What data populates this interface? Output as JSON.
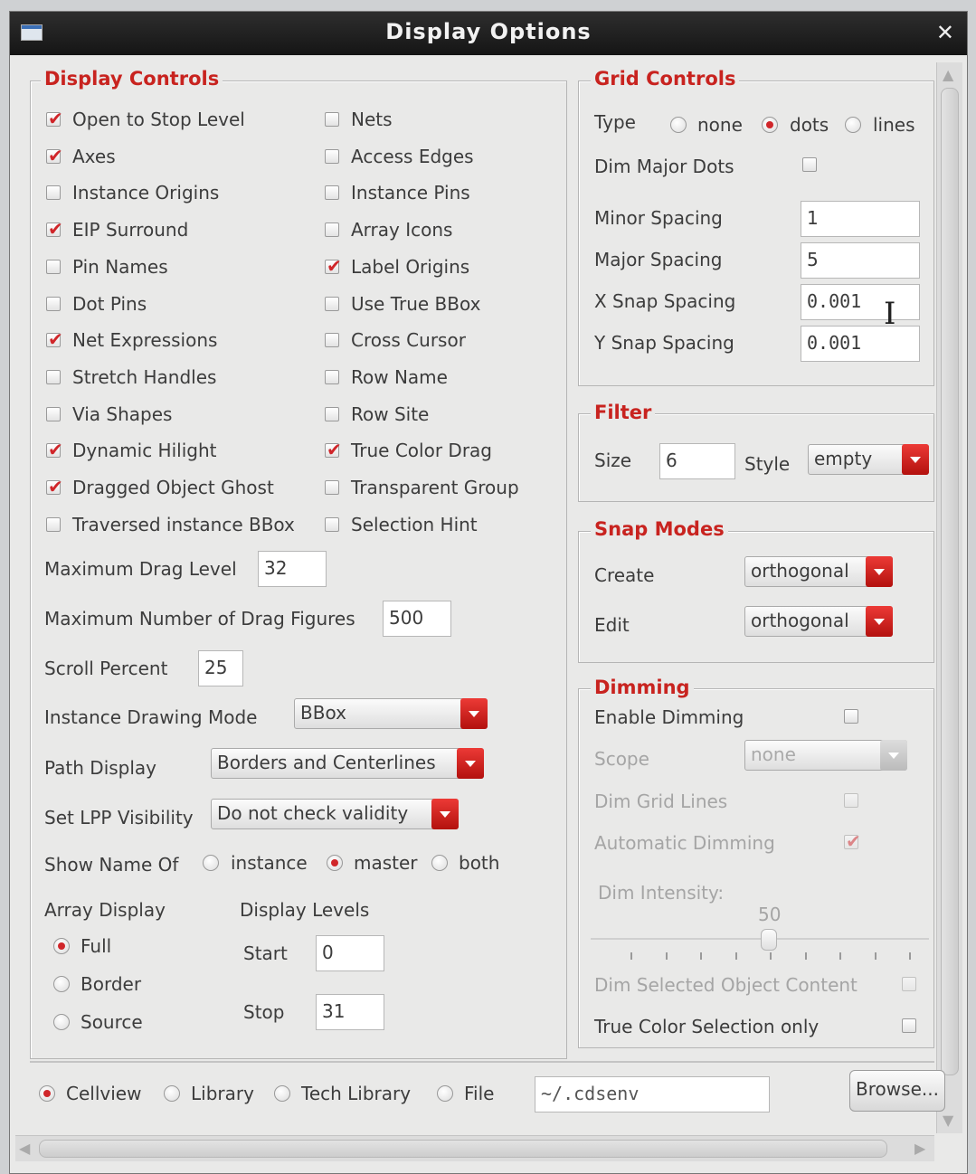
{
  "window": {
    "title": "Display Options"
  },
  "display_controls": {
    "legend": "Display Controls",
    "left_checks": [
      {
        "label": "Open to Stop Level",
        "checked": true
      },
      {
        "label": "Axes",
        "checked": true
      },
      {
        "label": "Instance Origins",
        "checked": false
      },
      {
        "label": "EIP Surround",
        "checked": true
      },
      {
        "label": "Pin Names",
        "checked": false
      },
      {
        "label": "Dot Pins",
        "checked": false
      },
      {
        "label": "Net Expressions",
        "checked": true
      },
      {
        "label": "Stretch Handles",
        "checked": false
      },
      {
        "label": "Via Shapes",
        "checked": false
      },
      {
        "label": "Dynamic Hilight",
        "checked": true
      },
      {
        "label": "Dragged Object Ghost",
        "checked": true
      },
      {
        "label": "Traversed instance BBox",
        "checked": false
      }
    ],
    "right_checks": [
      {
        "label": "Nets",
        "checked": false
      },
      {
        "label": "Access Edges",
        "checked": false
      },
      {
        "label": "Instance Pins",
        "checked": false
      },
      {
        "label": "Array Icons",
        "checked": false
      },
      {
        "label": "Label Origins",
        "checked": true
      },
      {
        "label": "Use True BBox",
        "checked": false
      },
      {
        "label": "Cross Cursor",
        "checked": false
      },
      {
        "label": "Row Name",
        "checked": false
      },
      {
        "label": "Row Site",
        "checked": false
      },
      {
        "label": "True Color Drag",
        "checked": true
      },
      {
        "label": "Transparent Group",
        "checked": false
      },
      {
        "label": "Selection Hint",
        "checked": false
      }
    ],
    "max_drag_level": {
      "label": "Maximum Drag Level",
      "value": "32"
    },
    "max_drag_figures": {
      "label": "Maximum Number of Drag Figures",
      "value": "500"
    },
    "scroll_percent": {
      "label": "Scroll Percent",
      "value": "25"
    },
    "instance_drawing_mode": {
      "label": "Instance Drawing Mode",
      "value": "BBox"
    },
    "path_display": {
      "label": "Path Display",
      "value": "Borders and Centerlines"
    },
    "set_lpp_visibility": {
      "label": "Set LPP Visibility",
      "value": "Do not check validity"
    },
    "show_name_of": {
      "label": "Show Name Of",
      "options": [
        "instance",
        "master",
        "both"
      ],
      "selected": "master"
    },
    "array_display": {
      "label": "Array Display",
      "options": [
        "Full",
        "Border",
        "Source"
      ],
      "selected": "Full"
    },
    "display_levels": {
      "label": "Display Levels",
      "start_label": "Start",
      "start": "0",
      "stop_label": "Stop",
      "stop": "31"
    }
  },
  "grid_controls": {
    "legend": "Grid Controls",
    "type": {
      "label": "Type",
      "options": [
        "none",
        "dots",
        "lines"
      ],
      "selected": "dots"
    },
    "dim_major_dots": {
      "label": "Dim Major Dots",
      "checked": false
    },
    "minor_spacing": {
      "label": "Minor Spacing",
      "value": "1"
    },
    "major_spacing": {
      "label": "Major Spacing",
      "value": "5"
    },
    "x_snap_spacing": {
      "label": "X Snap Spacing",
      "value": "0.001"
    },
    "y_snap_spacing": {
      "label": "Y Snap Spacing",
      "value": "0.001"
    }
  },
  "filter": {
    "legend": "Filter",
    "size_label": "Size",
    "size": "6",
    "style_label": "Style",
    "style": "empty"
  },
  "snap_modes": {
    "legend": "Snap Modes",
    "create_label": "Create",
    "create": "orthogonal",
    "edit_label": "Edit",
    "edit": "orthogonal"
  },
  "dimming": {
    "legend": "Dimming",
    "enable": {
      "label": "Enable Dimming",
      "checked": false
    },
    "scope": {
      "label": "Scope",
      "value": "none"
    },
    "dim_grid_lines": {
      "label": "Dim Grid Lines",
      "checked": false
    },
    "automatic_dimming": {
      "label": "Automatic Dimming",
      "checked": true
    },
    "intensity": {
      "label": "Dim Intensity:",
      "value": "50"
    },
    "dim_selected": {
      "label": "Dim Selected Object Content",
      "checked": false
    },
    "true_color": {
      "label": "True Color Selection only",
      "checked": false
    }
  },
  "save_target": {
    "options": [
      "Cellview",
      "Library",
      "Tech Library",
      "File"
    ],
    "selected": "Cellview",
    "path": "~/.cdsenv",
    "browse_label": "Browse..."
  }
}
